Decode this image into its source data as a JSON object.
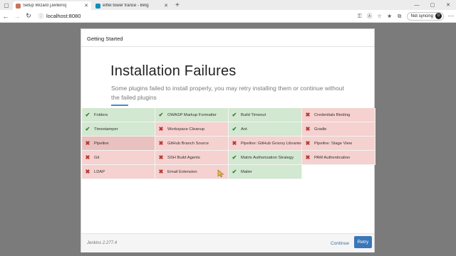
{
  "browser": {
    "tabs": [
      {
        "label": "Setup Wizard [Jenkins]",
        "favicon_color": "#c9745a",
        "active": true
      },
      {
        "label": "eiffel tower france - Bing",
        "favicon_color": "#0a8fbd",
        "active": false
      }
    ],
    "new_tab": "+",
    "url": "localhost:8080",
    "sync_label": "Not syncing"
  },
  "modal": {
    "header": "Getting Started",
    "headline": "Installation Failures",
    "subtitle": "Some plugins failed to install properly, you may retry installing them or continue without the failed plugins",
    "plugins": [
      {
        "name": "Folders",
        "status": "success"
      },
      {
        "name": "OWASP Markup Formatter",
        "status": "success"
      },
      {
        "name": "Build Timeout",
        "status": "success"
      },
      {
        "name": "Credentials Binding",
        "status": "failure"
      },
      {
        "name": "Timestamper",
        "status": "success"
      },
      {
        "name": "Workspace Cleanup",
        "status": "failure"
      },
      {
        "name": "Ant",
        "status": "success"
      },
      {
        "name": "Gradle",
        "status": "failure"
      },
      {
        "name": "Pipeline",
        "status": "failure"
      },
      {
        "name": "GitHub Branch Source",
        "status": "failure"
      },
      {
        "name": "Pipeline: GitHub Groovy Libraries",
        "status": "failure"
      },
      {
        "name": "Pipeline: Stage View",
        "status": "failure"
      },
      {
        "name": "Git",
        "status": "failure"
      },
      {
        "name": "SSH Build Agents",
        "status": "failure"
      },
      {
        "name": "Matrix Authorization Strategy",
        "status": "success"
      },
      {
        "name": "PAM Authentication",
        "status": "failure"
      },
      {
        "name": "LDAP",
        "status": "failure"
      },
      {
        "name": "Email Extension",
        "status": "failure"
      },
      {
        "name": "Mailer",
        "status": "success"
      }
    ],
    "hovered_plugin": "Pipeline",
    "footer": {
      "version": "Jenkins 2.277.4",
      "continue_label": "Continue",
      "retry_label": "Retry"
    }
  },
  "colors": {
    "success_bg": "#d2e8d0",
    "failure_bg": "#f5d1cf",
    "accent": "#3a76b9"
  },
  "icons": {
    "success": "check-icon",
    "failure": "x-icon"
  }
}
